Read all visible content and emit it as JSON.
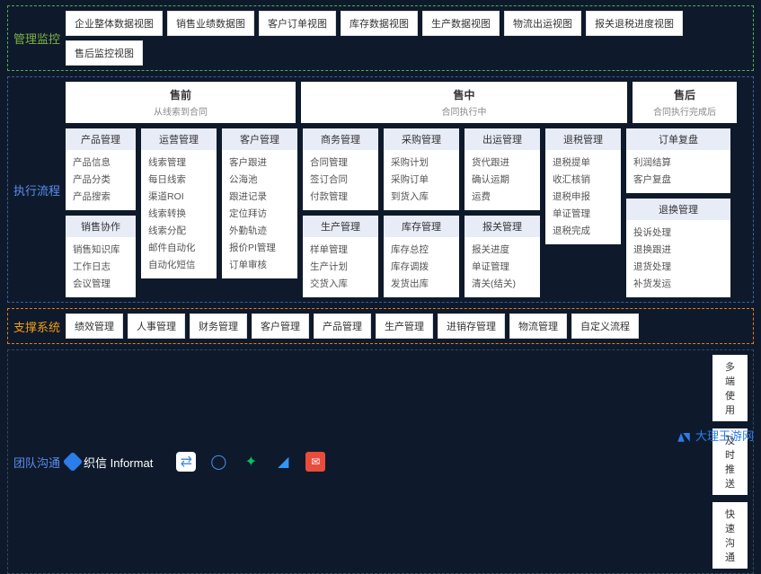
{
  "sections": {
    "monitor": {
      "label": "管理监控",
      "items": [
        "企业整体数据视图",
        "销售业绩数据图",
        "客户订单视图",
        "库存数据视图",
        "生产数据视图",
        "物流出运视图",
        "报关退税进度视图",
        "售后监控视图"
      ]
    },
    "process": {
      "label": "执行流程",
      "phases": [
        {
          "title": "售前",
          "sub": "从线索到合同"
        },
        {
          "title": "售中",
          "sub": "合同执行中"
        },
        {
          "title": "售后",
          "sub": "合同执行完成后"
        }
      ],
      "columns": [
        {
          "w": "c1",
          "cards": [
            {
              "h": "产品管理",
              "items": [
                "产品信息",
                "产品分类",
                "产品搜索"
              ]
            },
            {
              "h": "销售协作",
              "items": [
                "销售知识库",
                "工作日志",
                "会议管理"
              ]
            }
          ]
        },
        {
          "w": "c2",
          "cards": [
            {
              "h": "运营管理",
              "items": [
                "线索管理",
                "每日线索",
                "渠道ROI",
                "线索转换",
                "线索分配",
                "邮件自动化",
                "自动化短信"
              ]
            }
          ]
        },
        {
          "w": "c3",
          "cards": [
            {
              "h": "客户管理",
              "items": [
                "客户跟进",
                "公海池",
                "跟进记录",
                "定位拜访",
                "外勤轨迹",
                "报价PI管理",
                "订单审核"
              ]
            }
          ]
        },
        {
          "w": "c4",
          "cards": [
            {
              "h": "商务管理",
              "items": [
                "合同管理",
                "签订合同",
                "付款管理"
              ]
            },
            {
              "h": "生产管理",
              "items": [
                "样单管理",
                "生产计划",
                "交货入库"
              ]
            }
          ]
        },
        {
          "w": "c5",
          "cards": [
            {
              "h": "采购管理",
              "items": [
                "采购计划",
                "采购订单",
                "到货入库"
              ]
            },
            {
              "h": "库存管理",
              "items": [
                "库存总控",
                "库存调拨",
                "发货出库"
              ]
            }
          ]
        },
        {
          "w": "c6",
          "cards": [
            {
              "h": "出运管理",
              "items": [
                "货代跟进",
                "确认运期",
                "运费"
              ]
            },
            {
              "h": "报关管理",
              "items": [
                "报关进度",
                "单证管理",
                "清关(结关)"
              ]
            }
          ]
        },
        {
          "w": "c7",
          "cards": [
            {
              "h": "退税管理",
              "items": [
                "退税提单",
                "收汇核销",
                "退税申报",
                "单证管理",
                "退税完成"
              ]
            }
          ]
        },
        {
          "w": "c8",
          "cards": [
            {
              "h": "订单复盘",
              "items": [
                "利润结算",
                "客户复盘"
              ]
            },
            {
              "h": "退换管理",
              "items": [
                "投诉处理",
                "退换跟进",
                "退货处理",
                "补货发运"
              ]
            }
          ]
        }
      ]
    },
    "support": {
      "label": "支撑系统",
      "items": [
        "绩效管理",
        "人事管理",
        "财务管理",
        "客户管理",
        "产品管理",
        "生产管理",
        "进销存管理",
        "物流管理",
        "自定义流程"
      ]
    },
    "comm": {
      "label": "团队沟通",
      "brand": "织信 Informat",
      "pills": [
        "多端使用",
        "及时推送",
        "快速沟通"
      ]
    }
  },
  "watermark": "大理王游网"
}
